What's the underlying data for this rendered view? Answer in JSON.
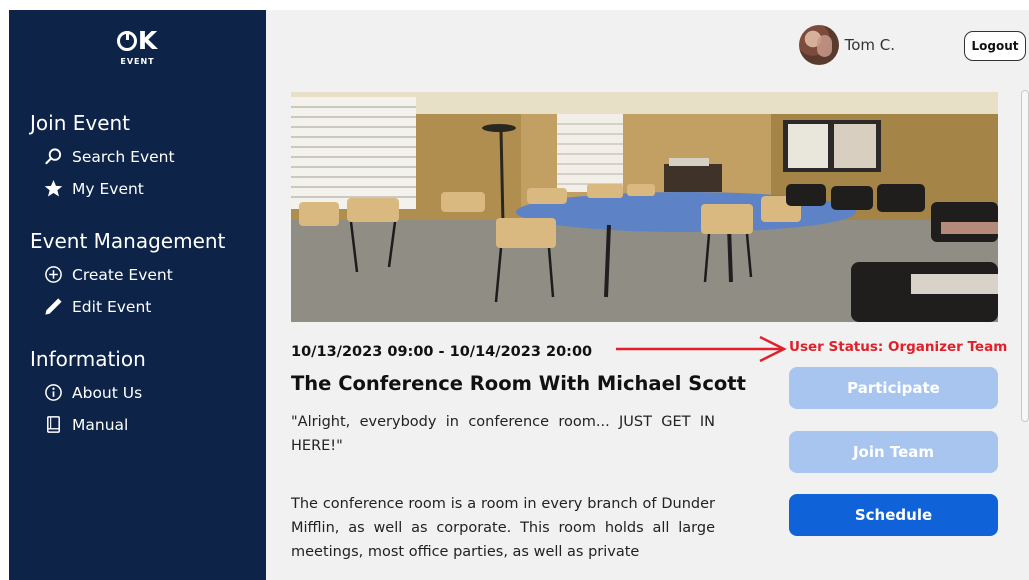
{
  "brand": {
    "logo_text": "K",
    "logo_sub": "EVENT"
  },
  "sidebar": {
    "sections": [
      {
        "heading": "Join Event",
        "items": [
          {
            "label": "Search Event",
            "icon": "search-icon"
          },
          {
            "label": "My Event",
            "icon": "star-icon"
          }
        ]
      },
      {
        "heading": "Event Management",
        "items": [
          {
            "label": "Create Event",
            "icon": "plus-circle-icon"
          },
          {
            "label": "Edit Event",
            "icon": "pencil-icon"
          }
        ]
      },
      {
        "heading": "Information",
        "items": [
          {
            "label": "About Us",
            "icon": "info-circle-icon"
          },
          {
            "label": "Manual",
            "icon": "book-icon"
          }
        ]
      }
    ]
  },
  "header": {
    "user_name": "Tom C.",
    "logout_label": "Logout"
  },
  "event": {
    "datetime": "10/13/2023 09:00 - 10/14/2023 20:00",
    "title": "The Conference Room With Michael Scott",
    "quote": "\"Alright, everybody in conference room... JUST GET IN HERE!\"",
    "description": "The conference room is a room in every branch of Dunder Mifflin, as well as corporate. This room holds all large meetings, most office parties, as well as private"
  },
  "status": {
    "user_status": "User Status: Organizer Team"
  },
  "actions": {
    "participate_label": "Participate",
    "join_team_label": "Join Team",
    "schedule_label": "Schedule"
  },
  "colors": {
    "sidebar_bg": "#0d2347",
    "primary": "#0f62d8",
    "disabled": "#a8c5ef",
    "status_red": "#e0202a"
  }
}
